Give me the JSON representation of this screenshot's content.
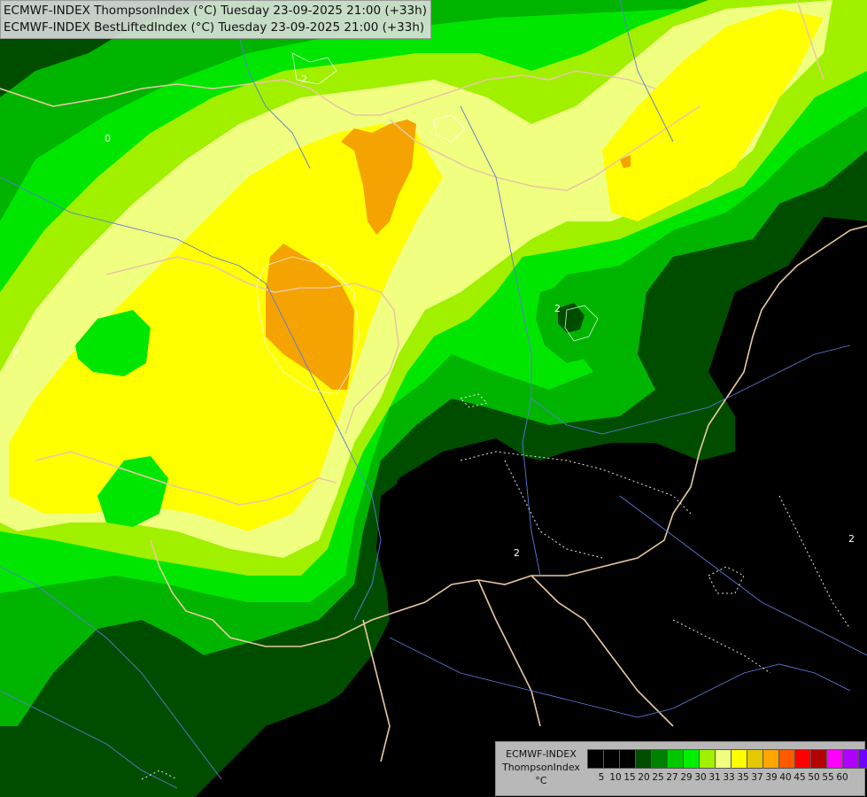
{
  "header": {
    "line1": "ECMWF-INDEX ThompsonIndex (°C) Tuesday 23-09-2025 21:00 (+33h)",
    "line2": "ECMWF-INDEX BestLiftedIndex (°C) Tuesday 23-09-2025 21:00 (+33h)"
  },
  "legend": {
    "model": "ECMWF-INDEX",
    "param": "ThompsonIndex",
    "unit": "°C",
    "ticks": [
      "5",
      "10",
      "15",
      "20",
      "25",
      "27",
      "29",
      "30",
      "31",
      "33",
      "35",
      "37",
      "39",
      "40",
      "45",
      "50",
      "55",
      "60"
    ],
    "colors": [
      "#000000",
      "#000000",
      "#000000",
      "#004d00",
      "#008000",
      "#00c800",
      "#00f000",
      "#a0f000",
      "#f0ff80",
      "#ffff00",
      "#e6c800",
      "#ffa500",
      "#ff5a00",
      "#ff0000",
      "#b40000",
      "#ff00ff",
      "#b000ff",
      "#6e00ff",
      "#0000ff"
    ]
  },
  "contour_labels": [
    "2",
    "2",
    "2",
    "2",
    "0",
    "0"
  ]
}
